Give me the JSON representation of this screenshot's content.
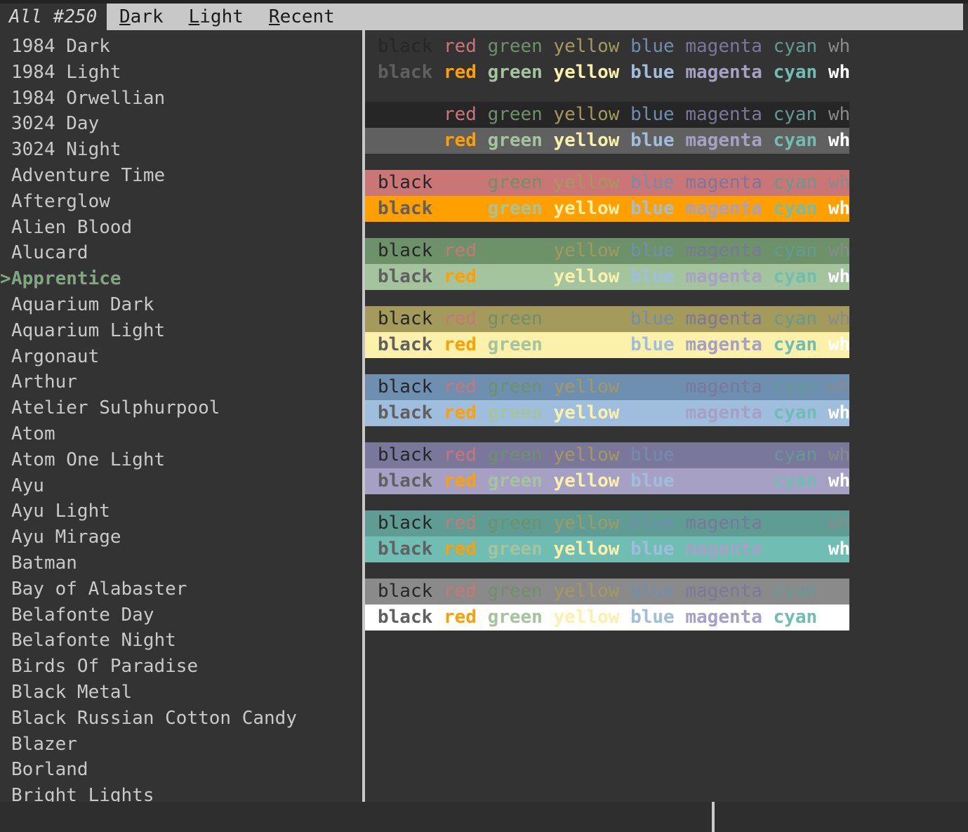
{
  "header": {
    "count_label": "All #250",
    "tabs": [
      {
        "name": "dark",
        "accel": "D",
        "rest": "ark"
      },
      {
        "name": "light",
        "accel": "L",
        "rest": "ight"
      },
      {
        "name": "recent",
        "accel": "R",
        "rest": "ecent"
      }
    ]
  },
  "theme_list": {
    "selected": "Apprentice",
    "selection_prefix": ">",
    "items": [
      "1984 Dark",
      "1984 Light",
      "1984 Orwellian",
      "3024 Day",
      "3024 Night",
      "Adventure Time",
      "Afterglow",
      "Alien Blood",
      "Alucard",
      "Apprentice",
      "Aquarium Dark",
      "Aquarium Light",
      "Argonaut",
      "Arthur",
      "Atelier Sulphurpool",
      "Atom",
      "Atom One Light",
      "Ayu",
      "Ayu Light",
      "Ayu Mirage",
      "Batman",
      "Bay of Alabaster",
      "Belafonte Day",
      "Belafonte Night",
      "Birds Of Paradise",
      "Black Metal",
      "Black Russian Cotton Candy",
      "Blazer",
      "Borland",
      "Bright Lights"
    ]
  },
  "preview": {
    "words": [
      "black",
      "red",
      "green",
      "yellow",
      "blue",
      "magenta",
      "cyan",
      "white"
    ],
    "palette": {
      "background": "#333333",
      "normal": {
        "black": "#262626",
        "red": "#cb7676",
        "green": "#6d9168",
        "yellow": "#a39a5c",
        "blue": "#6f8fb0",
        "magenta": "#7b779b",
        "cyan": "#5f9c93",
        "white": "#8a8a8a"
      },
      "bright": {
        "black": "#606060",
        "red": "#ff9f00",
        "green": "#a4c49e",
        "yellow": "#fbf1ab",
        "blue": "#9fbede",
        "magenta": "#a6a0c4",
        "cyan": "#6fbdb3",
        "white": "#ffffff"
      }
    },
    "blocks": [
      {
        "name": "default",
        "bg_normal": null,
        "bg_bright": null,
        "hidden": null
      },
      {
        "name": "black",
        "bg_normal": "#262626",
        "bg_bright": "#606060",
        "hidden": "black"
      },
      {
        "name": "red",
        "bg_normal": "#cb7676",
        "bg_bright": "#ff9f00",
        "hidden": "red"
      },
      {
        "name": "green",
        "bg_normal": "#6d9168",
        "bg_bright": "#a4c49e",
        "hidden": "green"
      },
      {
        "name": "yellow",
        "bg_normal": "#a39a5c",
        "bg_bright": "#fbf1ab",
        "hidden": "yellow"
      },
      {
        "name": "blue",
        "bg_normal": "#6f8fb0",
        "bg_bright": "#9fbede",
        "hidden": "blue"
      },
      {
        "name": "magenta",
        "bg_normal": "#7b779b",
        "bg_bright": "#a6a0c4",
        "hidden": "magenta"
      },
      {
        "name": "cyan",
        "bg_normal": "#5f9c93",
        "bg_bright": "#6fbdb3",
        "hidden": "cyan"
      },
      {
        "name": "white",
        "bg_normal": "#8a8a8a",
        "bg_bright": "#ffffff",
        "hidden": "white"
      }
    ]
  }
}
